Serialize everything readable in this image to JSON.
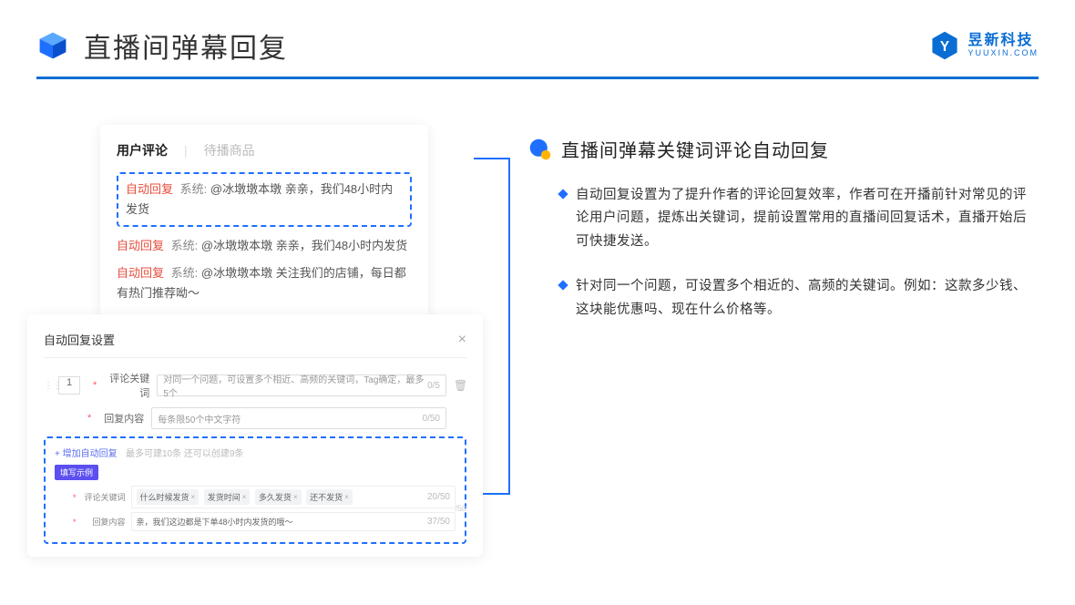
{
  "header": {
    "title": "直播间弹幕回复",
    "brand_name": "昱新科技",
    "brand_sub": "YUUXIN.COM"
  },
  "comments_card": {
    "tab_active": "用户评论",
    "tab_inactive": "待播商品",
    "highlight": {
      "tag": "自动回复",
      "sys": "系统:",
      "text": "@冰墩墩本墩 亲亲，我们48小时内发货"
    },
    "lines": [
      {
        "tag": "自动回复",
        "sys": "系统:",
        "text": "@冰墩墩本墩 亲亲，我们48小时内发货"
      },
      {
        "tag": "自动回复",
        "sys": "系统:",
        "text": "@冰墩墩本墩 关注我们的店铺，每日都有热门推荐呦～"
      }
    ]
  },
  "settings_card": {
    "title": "自动回复设置",
    "index": "1",
    "keyword_label": "评论关键词",
    "keyword_placeholder": "对同一个问题，可设置多个相近、高频的关键词，Tag确定，最多5个",
    "keyword_counter": "0/5",
    "content_label": "回复内容",
    "content_placeholder": "每条限50个中文字符",
    "content_counter": "0/50",
    "add_link": "+ 增加自动回复",
    "add_hint": "最多可建10条 还可以创建9条",
    "example_badge": "填写示例",
    "example": {
      "keyword_label": "评论关键词",
      "tags": [
        "什么时候发货",
        "发货时间",
        "多久发货",
        "还不发货"
      ],
      "keyword_counter": "20/50",
      "content_label": "回复内容",
      "content_value": "亲，我们这边都是下单48小时内发货的哦～",
      "content_counter": "37/50",
      "outer_counter": "/50"
    }
  },
  "right": {
    "section_title": "直播间弹幕关键词评论自动回复",
    "bullets": [
      "自动回复设置为了提升作者的评论回复效率，作者可在开播前针对常见的评论用户问题，提炼出关键词，提前设置常用的直播间回复话术，直播开始后可快捷发送。",
      "针对同一个问题，可设置多个相近的、高频的关键词。例如：这款多少钱、这块能优惠吗、现在什么价格等。"
    ]
  }
}
